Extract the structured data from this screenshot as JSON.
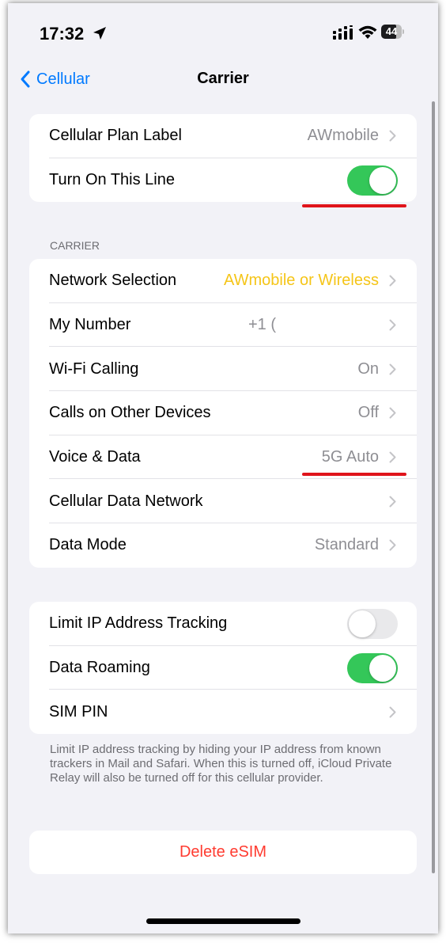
{
  "status_bar": {
    "time": "17:32",
    "battery": "44"
  },
  "nav": {
    "back_label": "Cellular",
    "title": "Carrier"
  },
  "line_group": {
    "plan_label": "Cellular Plan Label",
    "plan_value": "AWmobile",
    "turn_on_label": "Turn On This Line",
    "turn_on_state": true
  },
  "carrier_header": "CARRIER",
  "carrier_rows": [
    {
      "label": "Network Selection",
      "value": "AWmobile or Wireless",
      "value_color": "#f5c518"
    },
    {
      "label": "My Number",
      "value": "+1 ("
    },
    {
      "label": "Wi-Fi Calling",
      "value": "On"
    },
    {
      "label": "Calls on Other Devices",
      "value": "Off"
    },
    {
      "label": "Voice & Data",
      "value": "5G Auto"
    },
    {
      "label": "Cellular Data Network",
      "value": ""
    },
    {
      "label": "Data Mode",
      "value": "Standard"
    }
  ],
  "privacy_group": {
    "limit_ip_label": "Limit IP Address Tracking",
    "limit_ip_state": false,
    "roaming_label": "Data Roaming",
    "roaming_state": true,
    "sim_pin_label": "SIM PIN"
  },
  "footer_note": "Limit IP address tracking by hiding your IP address from known trackers in Mail and Safari. When this is turned off, iCloud Private Relay will also be turned off for this cellular provider.",
  "delete_label": "Delete eSIM",
  "colors": {
    "accent": "#007aff",
    "toggle_on": "#34c759",
    "destructive": "#ff3b30",
    "annotation_underline": "#e0141b",
    "highlight_value": "#f5c518"
  }
}
